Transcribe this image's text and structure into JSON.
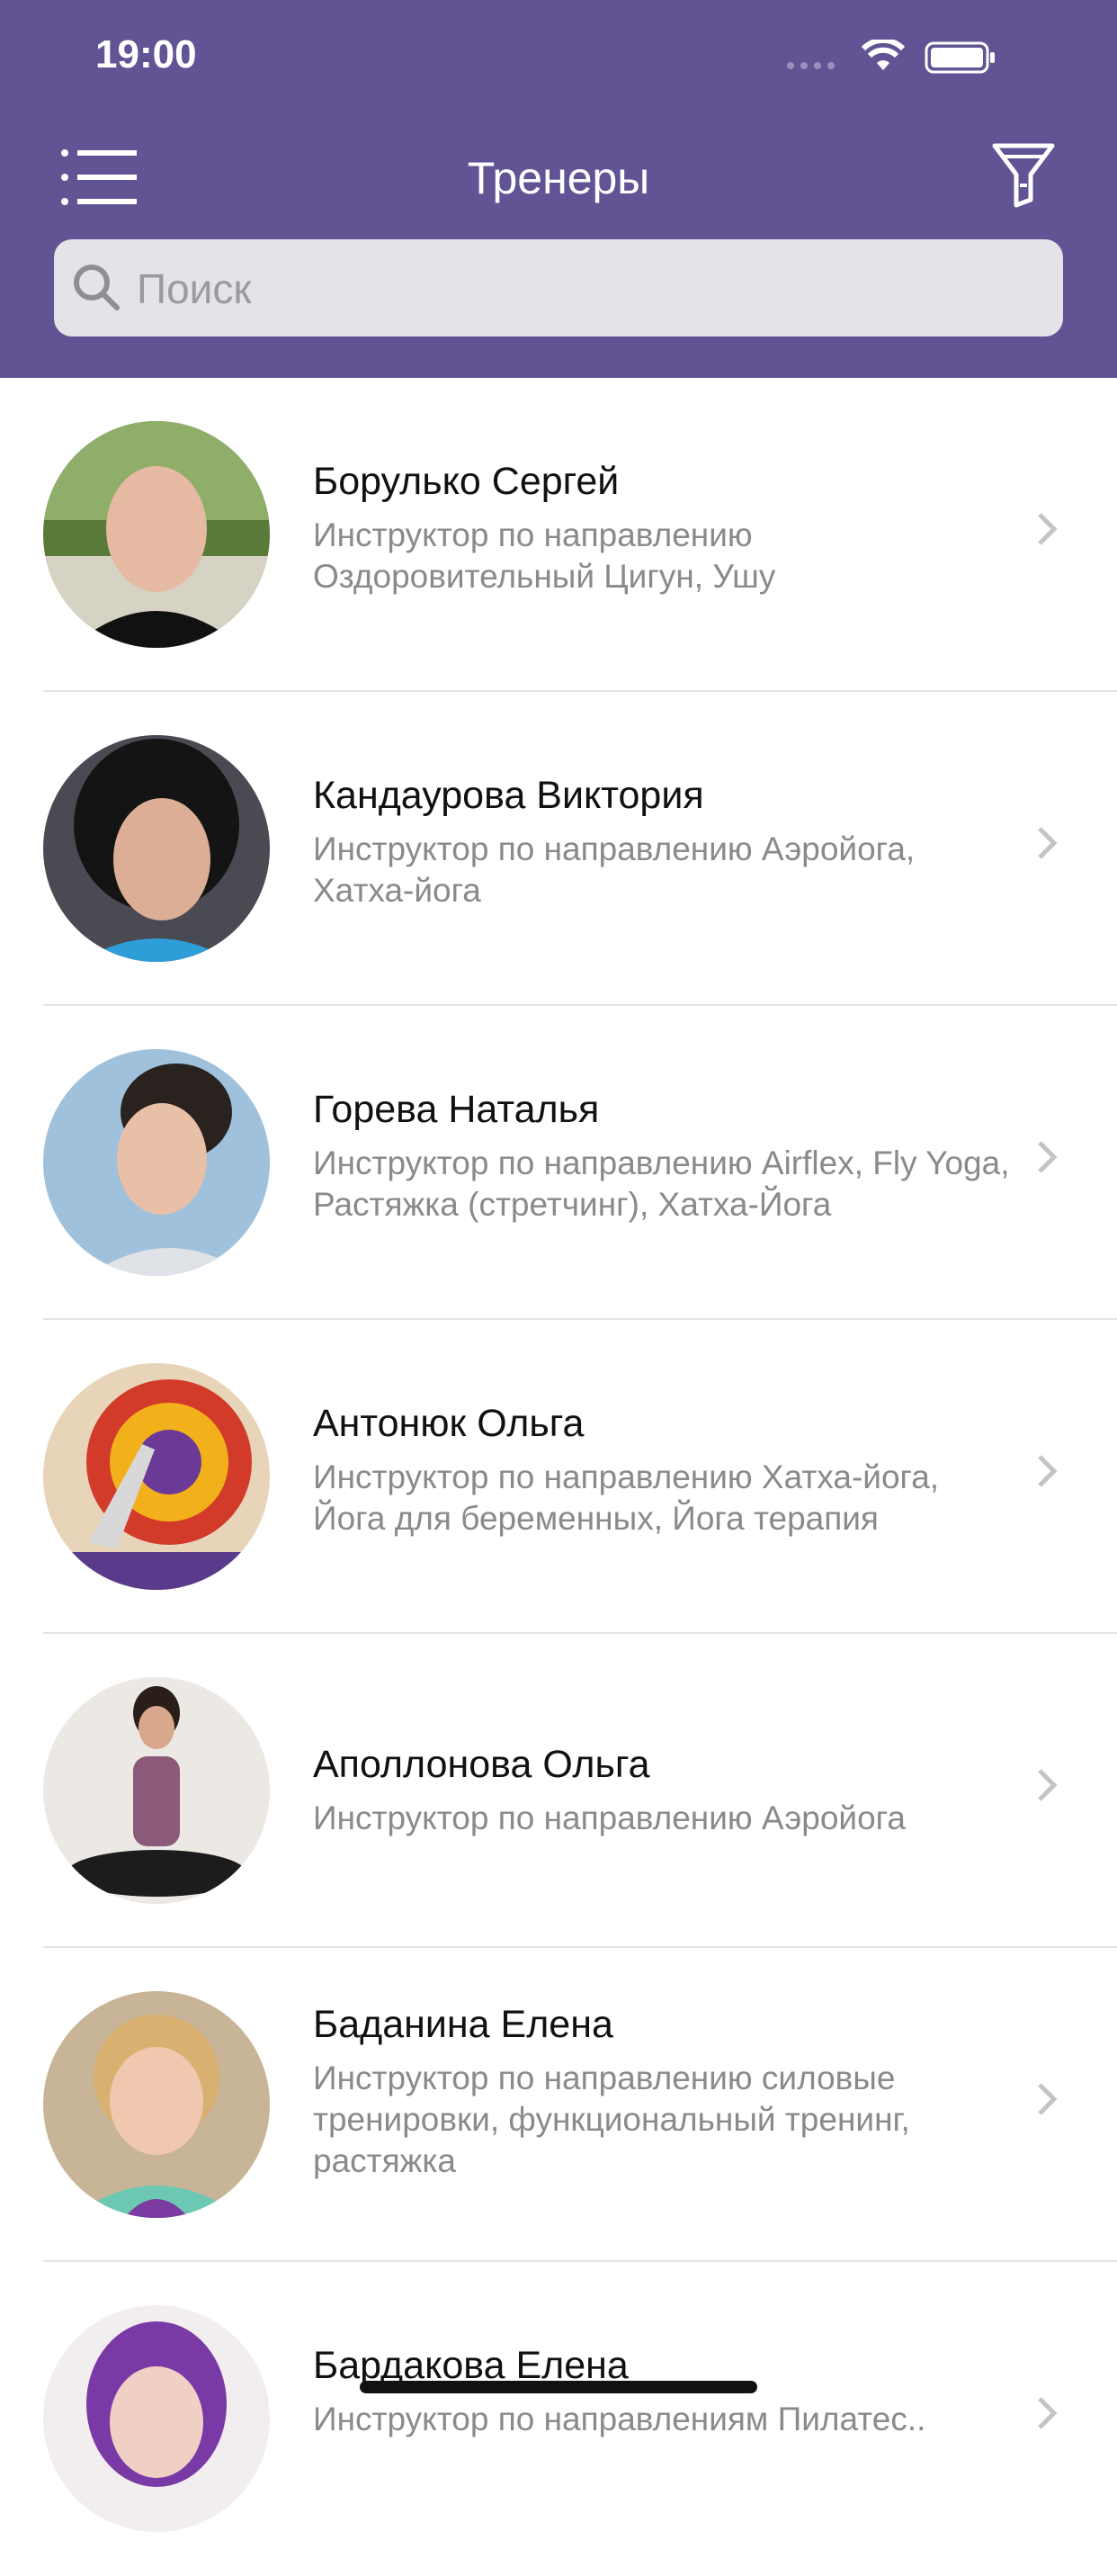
{
  "status_bar": {
    "time": "19:00"
  },
  "header": {
    "title": "Тренеры"
  },
  "search": {
    "placeholder": "Поиск"
  },
  "trainers": [
    {
      "name": "Борулько Сергей",
      "description": "Инструктор по направлению Оздоровительный Цигун, Ушу"
    },
    {
      "name": "Кандаурова Виктория",
      "description": "Инструктор по направлению Аэройога, Хатха-йога"
    },
    {
      "name": "Горева Наталья",
      "description": "Инструктор по направлению Airflex, Fly Yoga, Растяжка (стретчинг), Хатха-Йога"
    },
    {
      "name": "Антонюк Ольга",
      "description": "Инструктор по направлению Хатха-йога, Йога для беременных, Йога терапия"
    },
    {
      "name": "Аполлонова Ольга",
      "description": "Инструктор по направлению Аэройога"
    },
    {
      "name": "Баданина Елена",
      "description": "Инструктор по направлению силовые тренировки, функциональный тренинг, растяжка"
    },
    {
      "name": "Бардакова Елена",
      "description": "Инструктор по направлениям Пилатес.."
    }
  ],
  "colors": {
    "header_bg": "#625494",
    "search_bg": "#e4e3e8"
  }
}
